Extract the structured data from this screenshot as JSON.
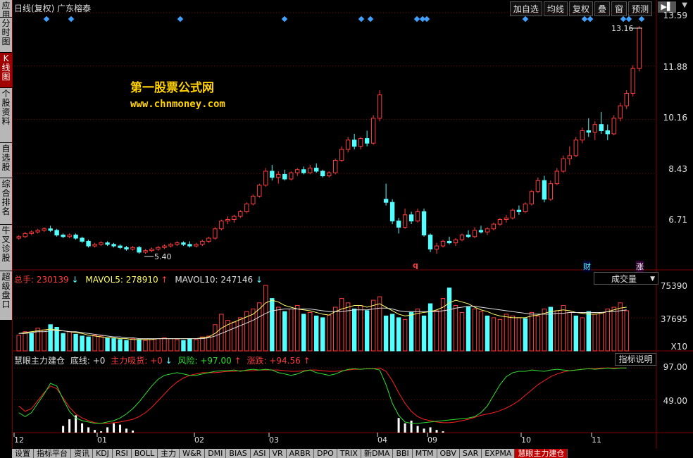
{
  "header": {
    "title": "日线(复权)  广东榕泰",
    "toolbar": [
      "加自选",
      "均线",
      "复权",
      "叠",
      "窗",
      "预测"
    ],
    "arrows": "▶▌"
  },
  "left_rail": [
    {
      "label": "应用"
    },
    {
      "label": "分时图"
    },
    {
      "label": "K线图"
    },
    {
      "label": "个股资料"
    },
    {
      "label": "自选股"
    },
    {
      "label": "综合排名"
    },
    {
      "label": "牛叉诊股"
    },
    {
      "label": "超级盘口"
    }
  ],
  "watermark": {
    "line1": "第一股票公式网",
    "line2": "www.chnmoney.com"
  },
  "price_axis": [
    "13.59",
    "11.88",
    "10.16",
    "8.43",
    "6.71"
  ],
  "annotations": {
    "high": "13.16",
    "low": "5.40",
    "mark_q": "q",
    "mark_cai": "财",
    "mark_zhang": "涨"
  },
  "volume_pane": {
    "total_label": "总手: 230139",
    "mavol5_label": "MAVOL5: 278910",
    "mavol10_label": "MAVOL10: 247146",
    "dropdown": "成交量",
    "axis": [
      "75390",
      "37695",
      "X10"
    ]
  },
  "indicator_pane": {
    "name": "慧眼主力建仓",
    "bottom_line": "底线: +0",
    "absorb": "主力吸货: +0",
    "risk": "风险: +97.00",
    "rise": "涨跌: +94.56",
    "help_button": "指标说明",
    "axis": [
      "97.00",
      "49.00"
    ]
  },
  "months": [
    "12",
    "01",
    "02",
    "03",
    "04",
    "09",
    "10",
    "11"
  ],
  "bottom_tabs": [
    "设置",
    "指标平台",
    "资讯",
    "KDJ",
    "RSI",
    "BOLL",
    "主力",
    "W&R",
    "DMI",
    "BIAS",
    "ASI",
    "VR",
    "ARBR",
    "DPO",
    "TRIX",
    "新DMA",
    "BBI",
    "MTM",
    "OBV",
    "SAR",
    "EXPMA",
    "慧眼主力建仓"
  ],
  "colors": {
    "up": "#ff3c3c",
    "down": "#54ffff",
    "grid": "#800000",
    "risk_line": "#ff2020",
    "rise_line": "#30e030"
  },
  "chart_data": {
    "type": "candlestick",
    "price": {
      "ylim": [
        5.4,
        13.59
      ],
      "ticks": [
        13.59,
        11.88,
        10.16,
        8.43,
        6.71
      ]
    },
    "candles": [
      [
        6.35,
        6.45,
        6.3,
        6.4
      ],
      [
        6.4,
        6.55,
        6.35,
        6.5
      ],
      [
        6.5,
        6.6,
        6.45,
        6.55
      ],
      [
        6.55,
        6.65,
        6.5,
        6.6
      ],
      [
        6.6,
        6.7,
        6.55,
        6.65
      ],
      [
        6.65,
        6.75,
        6.55,
        6.6
      ],
      [
        6.6,
        6.65,
        6.4,
        6.45
      ],
      [
        6.45,
        6.5,
        6.35,
        6.4
      ],
      [
        6.4,
        6.5,
        6.35,
        6.45
      ],
      [
        6.45,
        6.5,
        6.3,
        6.35
      ],
      [
        6.35,
        6.4,
        6.2,
        6.25
      ],
      [
        6.25,
        6.3,
        6.05,
        6.1
      ],
      [
        6.1,
        6.2,
        6.05,
        6.15
      ],
      [
        6.15,
        6.25,
        6.1,
        6.2
      ],
      [
        6.2,
        6.25,
        6.1,
        6.15
      ],
      [
        6.15,
        6.2,
        6.05,
        6.1
      ],
      [
        6.1,
        6.15,
        6.0,
        6.05
      ],
      [
        6.05,
        6.1,
        5.95,
        6.0
      ],
      [
        6.0,
        6.1,
        5.95,
        6.05
      ],
      [
        6.05,
        6.1,
        5.85,
        5.9
      ],
      [
        5.9,
        6.0,
        5.85,
        5.95
      ],
      [
        5.95,
        6.05,
        5.9,
        6.0
      ],
      [
        6.0,
        6.1,
        5.95,
        6.05
      ],
      [
        6.05,
        6.15,
        6.0,
        6.1
      ],
      [
        6.1,
        6.2,
        6.05,
        6.15
      ],
      [
        6.15,
        6.25,
        6.1,
        6.2
      ],
      [
        6.2,
        6.25,
        6.1,
        6.15
      ],
      [
        6.15,
        6.25,
        6.05,
        6.1
      ],
      [
        6.1,
        6.2,
        6.05,
        6.15
      ],
      [
        6.15,
        6.3,
        6.1,
        6.25
      ],
      [
        6.25,
        6.4,
        6.2,
        6.35
      ],
      [
        6.35,
        6.7,
        6.3,
        6.65
      ],
      [
        6.65,
        6.95,
        6.6,
        6.9
      ],
      [
        6.9,
        7.05,
        6.8,
        6.95
      ],
      [
        6.95,
        7.1,
        6.85,
        7.05
      ],
      [
        7.05,
        7.25,
        7.0,
        7.2
      ],
      [
        7.2,
        7.5,
        7.15,
        7.45
      ],
      [
        7.45,
        7.75,
        7.4,
        7.7
      ],
      [
        7.7,
        8.1,
        7.65,
        8.05
      ],
      [
        8.05,
        8.6,
        8.0,
        8.5
      ],
      [
        8.5,
        8.7,
        8.2,
        8.3
      ],
      [
        8.3,
        8.5,
        8.1,
        8.4
      ],
      [
        8.4,
        8.55,
        8.2,
        8.25
      ],
      [
        8.25,
        8.5,
        8.2,
        8.45
      ],
      [
        8.45,
        8.6,
        8.35,
        8.55
      ],
      [
        8.55,
        8.65,
        8.4,
        8.45
      ],
      [
        8.45,
        8.7,
        8.4,
        8.6
      ],
      [
        8.6,
        8.75,
        8.45,
        8.5
      ],
      [
        8.5,
        8.55,
        8.3,
        8.35
      ],
      [
        8.35,
        8.5,
        8.3,
        8.45
      ],
      [
        8.45,
        8.9,
        8.4,
        8.85
      ],
      [
        8.85,
        9.3,
        8.8,
        9.2
      ],
      [
        9.2,
        9.6,
        9.1,
        9.5
      ],
      [
        9.5,
        9.7,
        9.2,
        9.3
      ],
      [
        9.3,
        9.6,
        9.2,
        9.55
      ],
      [
        9.55,
        9.8,
        9.3,
        9.4
      ],
      [
        9.4,
        10.3,
        9.35,
        10.2
      ],
      [
        10.2,
        11.1,
        10.1,
        10.95
      ],
      [
        7.6,
        8.1,
        7.4,
        7.5
      ],
      [
        7.5,
        7.6,
        6.8,
        6.9
      ],
      [
        6.9,
        7.0,
        6.5,
        6.7
      ],
      [
        6.7,
        7.3,
        6.65,
        7.1
      ],
      [
        7.1,
        7.2,
        6.8,
        6.9
      ],
      [
        6.9,
        7.3,
        6.85,
        7.2
      ],
      [
        7.2,
        7.3,
        6.4,
        6.45
      ],
      [
        6.45,
        6.5,
        5.9,
        6.0
      ],
      [
        6.0,
        6.2,
        5.85,
        6.1
      ],
      [
        6.1,
        6.3,
        6.05,
        6.25
      ],
      [
        6.25,
        6.4,
        6.15,
        6.2
      ],
      [
        6.2,
        6.35,
        6.1,
        6.3
      ],
      [
        6.3,
        6.5,
        6.25,
        6.45
      ],
      [
        6.45,
        6.6,
        6.35,
        6.4
      ],
      [
        6.4,
        6.7,
        6.35,
        6.6
      ],
      [
        6.6,
        6.75,
        6.5,
        6.55
      ],
      [
        6.55,
        6.7,
        6.45,
        6.65
      ],
      [
        6.65,
        6.85,
        6.6,
        6.8
      ],
      [
        6.8,
        7.0,
        6.75,
        6.95
      ],
      [
        6.95,
        7.1,
        6.85,
        7.0
      ],
      [
        7.0,
        7.3,
        6.95,
        7.25
      ],
      [
        7.25,
        7.4,
        7.1,
        7.2
      ],
      [
        7.2,
        7.5,
        7.15,
        7.45
      ],
      [
        7.45,
        7.9,
        7.4,
        7.85
      ],
      [
        7.85,
        8.3,
        7.8,
        8.2
      ],
      [
        8.2,
        8.35,
        7.5,
        7.6
      ],
      [
        7.6,
        8.2,
        7.55,
        8.1
      ],
      [
        8.1,
        8.6,
        8.05,
        8.5
      ],
      [
        8.5,
        9.0,
        8.45,
        8.9
      ],
      [
        8.9,
        9.3,
        8.7,
        9.0
      ],
      [
        9.0,
        9.6,
        8.95,
        9.5
      ],
      [
        9.5,
        9.9,
        9.4,
        9.8
      ],
      [
        9.8,
        10.2,
        9.6,
        9.75
      ],
      [
        9.75,
        10.1,
        9.5,
        10.0
      ],
      [
        10.0,
        10.4,
        9.7,
        9.8
      ],
      [
        9.8,
        10.0,
        9.5,
        9.7
      ],
      [
        9.7,
        10.3,
        9.65,
        10.2
      ],
      [
        10.2,
        10.7,
        10.1,
        10.6
      ],
      [
        10.6,
        11.1,
        10.5,
        11.0
      ],
      [
        11.0,
        11.9,
        10.9,
        11.8
      ],
      [
        11.8,
        13.16,
        11.7,
        13.1
      ]
    ],
    "volume": {
      "ylim": [
        0,
        75390
      ],
      "ticks": [
        75390,
        37695
      ],
      "values": [
        18,
        22,
        20,
        26,
        24,
        30,
        27,
        20,
        22,
        19,
        17,
        16,
        18,
        17,
        15,
        14,
        13,
        12,
        14,
        13,
        12,
        13,
        14,
        15,
        14,
        13,
        12,
        14,
        13,
        16,
        17,
        30,
        42,
        35,
        33,
        38,
        45,
        48,
        55,
        75,
        60,
        50,
        45,
        48,
        52,
        42,
        44,
        40,
        38,
        41,
        50,
        60,
        55,
        48,
        52,
        46,
        58,
        62,
        40,
        42,
        38,
        36,
        44,
        48,
        40,
        54,
        46,
        60,
        72,
        52,
        44,
        50,
        48,
        45,
        40,
        38,
        36,
        42,
        40,
        38,
        37,
        44,
        40,
        48,
        50,
        46,
        52,
        44,
        40,
        38,
        45,
        42,
        44,
        48,
        50,
        55,
        46
      ],
      "up": [
        1,
        1,
        0,
        1,
        1,
        0,
        0,
        0,
        1,
        0,
        0,
        0,
        1,
        1,
        0,
        0,
        0,
        0,
        1,
        0,
        1,
        1,
        1,
        1,
        1,
        1,
        0,
        0,
        1,
        1,
        1,
        1,
        1,
        1,
        1,
        1,
        1,
        1,
        1,
        1,
        0,
        1,
        0,
        1,
        1,
        0,
        1,
        0,
        0,
        1,
        1,
        1,
        1,
        0,
        1,
        0,
        1,
        1,
        0,
        0,
        0,
        1,
        0,
        1,
        0,
        0,
        1,
        1,
        0,
        1,
        1,
        0,
        1,
        1,
        0,
        1,
        1,
        1,
        1,
        1,
        0,
        1,
        1,
        1,
        0,
        1,
        1,
        1,
        0,
        1,
        0,
        1,
        1,
        1,
        1,
        1,
        1
      ],
      "mavol5": [
        20,
        21,
        22,
        23,
        24,
        25,
        24,
        23,
        22,
        21,
        20,
        18,
        17,
        16,
        15,
        15,
        14,
        14,
        13,
        13,
        13,
        13,
        14,
        14,
        14,
        14,
        14,
        14,
        14,
        15,
        16,
        20,
        26,
        30,
        33,
        36,
        39,
        42,
        48,
        55,
        58,
        56,
        52,
        50,
        48,
        47,
        46,
        44,
        42,
        41,
        45,
        48,
        50,
        52,
        52,
        50,
        52,
        54,
        50,
        46,
        42,
        40,
        41,
        43,
        44,
        45,
        47,
        50,
        55,
        58,
        56,
        54,
        50,
        47,
        45,
        42,
        40,
        39,
        38,
        38,
        38,
        40,
        41,
        43,
        45,
        46,
        47,
        46,
        44,
        43,
        42,
        42,
        43,
        45,
        47,
        49,
        50
      ],
      "mavol10": [
        20,
        20,
        21,
        22,
        22,
        23,
        23,
        23,
        22,
        22,
        21,
        20,
        19,
        18,
        17,
        16,
        16,
        15,
        15,
        14,
        14,
        14,
        14,
        14,
        14,
        14,
        14,
        14,
        14,
        14,
        15,
        17,
        20,
        23,
        26,
        29,
        32,
        35,
        39,
        43,
        46,
        47,
        48,
        48,
        48,
        48,
        48,
        47,
        46,
        45,
        45,
        45,
        46,
        47,
        47,
        47,
        48,
        49,
        49,
        48,
        46,
        45,
        45,
        45,
        45,
        45,
        45,
        46,
        47,
        49,
        50,
        51,
        51,
        50,
        49,
        48,
        47,
        46,
        45,
        44,
        43,
        42,
        42,
        42,
        42,
        43,
        43,
        44,
        44,
        44,
        44,
        44,
        44,
        45,
        45,
        46,
        47
      ]
    },
    "indicator": {
      "ylim": [
        0,
        110
      ],
      "ticks": [
        97.0,
        49.0
      ],
      "risk": [
        40,
        32,
        36,
        48,
        60,
        70,
        66,
        52,
        38,
        28,
        22,
        18,
        15,
        14,
        14,
        15,
        16,
        18,
        20,
        24,
        30,
        38,
        48,
        58,
        68,
        76,
        82,
        86,
        88,
        90,
        90,
        90,
        91,
        92,
        92,
        93,
        93,
        93,
        94,
        94,
        94,
        94,
        93,
        92,
        92,
        93,
        94,
        94,
        93,
        92,
        92,
        93,
        94,
        95,
        95,
        96,
        96,
        97,
        92,
        78,
        60,
        44,
        32,
        24,
        20,
        18,
        16,
        15,
        15,
        16,
        18,
        20,
        23,
        26,
        28,
        30,
        33,
        37,
        42,
        48,
        56,
        64,
        72,
        78,
        84,
        88,
        91,
        93,
        94,
        95,
        96,
        96,
        97,
        97,
        97,
        97,
        97
      ],
      "rise": [
        30,
        24,
        30,
        44,
        58,
        74,
        70,
        50,
        32,
        22,
        18,
        16,
        14,
        14,
        16,
        18,
        22,
        28,
        36,
        46,
        58,
        70,
        80,
        86,
        88,
        90,
        88,
        86,
        86,
        88,
        90,
        92,
        93,
        93,
        94,
        92,
        94,
        95,
        94,
        95,
        94,
        90,
        88,
        86,
        88,
        92,
        94,
        90,
        88,
        86,
        88,
        92,
        95,
        96,
        95,
        96,
        96,
        94,
        72,
        44,
        26,
        16,
        14,
        14,
        15,
        16,
        17,
        18,
        19,
        20,
        21,
        22,
        24,
        30,
        40,
        56,
        72,
        84,
        90,
        92,
        92,
        94,
        93,
        92,
        94,
        95,
        94,
        93,
        94,
        95,
        96,
        95,
        96,
        97,
        96,
        97,
        97
      ],
      "bars": [
        0,
        0,
        0,
        0,
        0,
        0,
        0,
        10,
        20,
        26,
        14,
        8,
        4,
        2,
        8,
        14,
        12,
        6,
        3,
        0,
        0,
        0,
        0,
        0,
        0,
        0,
        0,
        0,
        0,
        0,
        0,
        0,
        0,
        0,
        0,
        0,
        0,
        0,
        0,
        0,
        0,
        0,
        0,
        0,
        0,
        0,
        0,
        0,
        0,
        0,
        0,
        0,
        0,
        0,
        0,
        0,
        0,
        0,
        0,
        0,
        22,
        14,
        18,
        10,
        6,
        8,
        4,
        2,
        0,
        0,
        0,
        0,
        0,
        0,
        0,
        0,
        0,
        0,
        0,
        0,
        0,
        0,
        0,
        0,
        0,
        0,
        0,
        0,
        0,
        0,
        0,
        0,
        0,
        0,
        0,
        0,
        0
      ]
    }
  }
}
